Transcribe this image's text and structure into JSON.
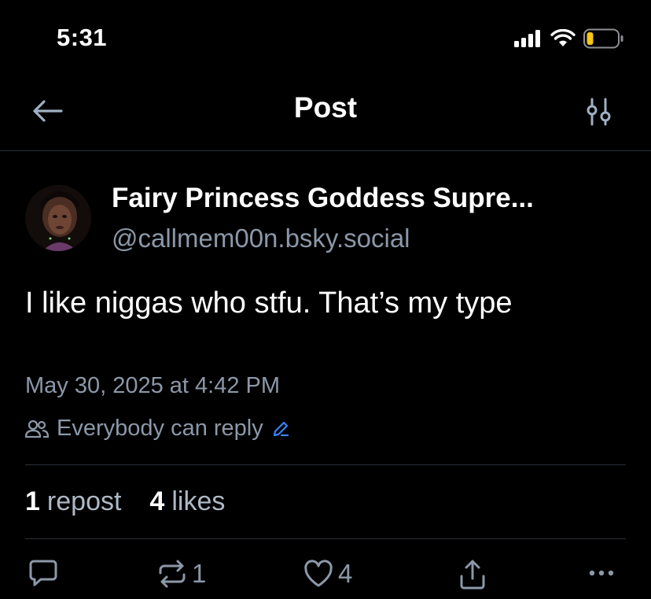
{
  "status_bar": {
    "time": "5:31",
    "battery_color": "#f5c518"
  },
  "header": {
    "title": "Post"
  },
  "post": {
    "author_display_name": "Fairy Princess Goddess Supre...",
    "author_handle": "@callmem00n.bsky.social",
    "text": "I like niggas who stfu. That’s my type",
    "timestamp": "May 30, 2025 at 4:42 PM",
    "reply_setting": "Everybody can reply"
  },
  "stats": {
    "reposts_count": "1",
    "reposts_label": "repost",
    "likes_count": "4",
    "likes_label": "likes"
  },
  "actions": {
    "repost_count": "1",
    "like_count": "4"
  },
  "colors": {
    "background": "#000000",
    "muted_text": "#8b98a8",
    "divider": "#2a2f36",
    "accent": "#3b82f6"
  }
}
